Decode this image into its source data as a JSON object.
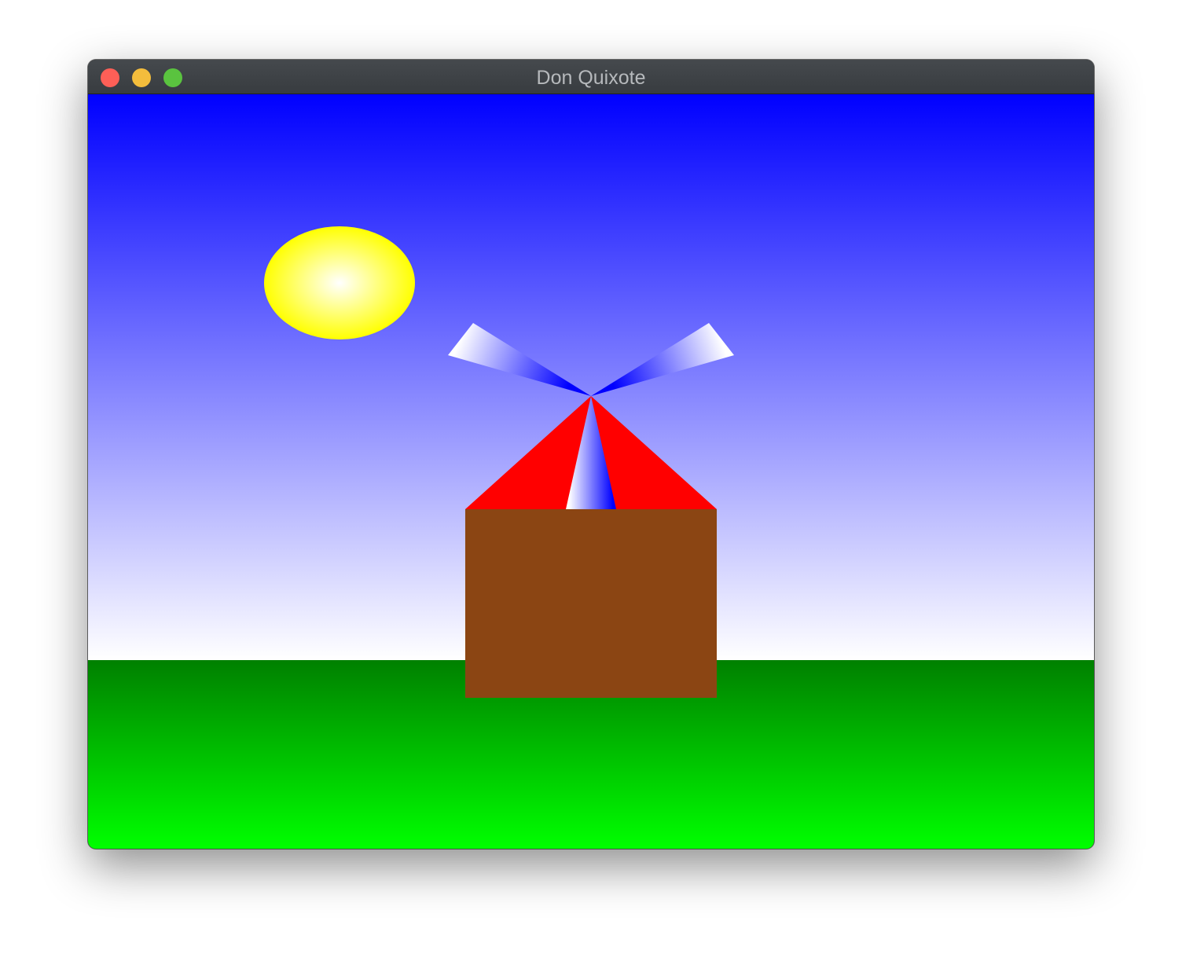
{
  "window": {
    "title": "Don Quixote"
  },
  "scene": {
    "sky_colors": [
      "#0000ff",
      "#ffffff"
    ],
    "ground_colors": [
      "#008000",
      "#00ff00"
    ],
    "sun_colors": [
      "#ffffff",
      "#ffff00"
    ],
    "roof_color": "#ff0000",
    "house_color": "#8b4513",
    "blade_colors": [
      "#0000ff",
      "#ffffff"
    ],
    "blade_count": 3
  }
}
